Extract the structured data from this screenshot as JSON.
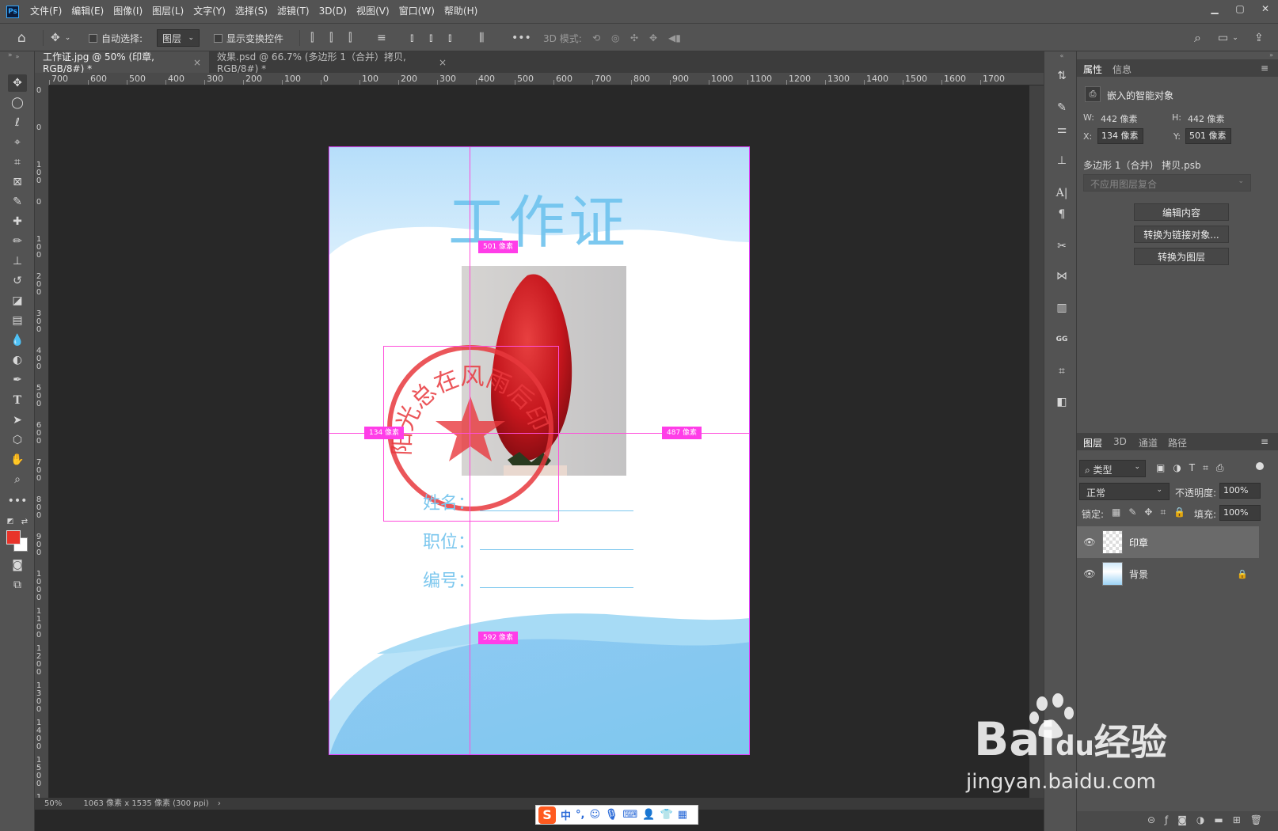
{
  "menubar": {
    "logo": "Ps",
    "items": [
      "文件(F)",
      "编辑(E)",
      "图像(I)",
      "图层(L)",
      "文字(Y)",
      "选择(S)",
      "滤镜(T)",
      "3D(D)",
      "视图(V)",
      "窗口(W)",
      "帮助(H)"
    ]
  },
  "options_bar": {
    "auto_select_label": "自动选择:",
    "auto_select_target": "图层",
    "show_transform_label": "显示变换控件",
    "mode_3d_label": "3D 模式:"
  },
  "tabs": [
    {
      "label": "工作证.jpg @ 50% (印章, RGB/8#) *",
      "active": true
    },
    {
      "label": "效果.psd @ 66.7% (多边形 1（合并）拷贝, RGB/8#) *",
      "active": false
    }
  ],
  "ruler_h": [
    "700",
    "600",
    "500",
    "400",
    "300",
    "200",
    "100",
    "0",
    "100",
    "200",
    "300",
    "400",
    "500",
    "600",
    "700",
    "800",
    "900",
    "1000",
    "1100",
    "1200",
    "1300",
    "1400",
    "1500",
    "1600",
    "1700"
  ],
  "ruler_v": [
    "0",
    "0",
    "1 0 0",
    "0",
    "1 0 0",
    "2 0 0",
    "3 0 0",
    "4 0 0",
    "5 0 0",
    "6 0 0",
    "7 0 0",
    "8 0 0",
    "9 0 0",
    "1 0 0 0",
    "1 1 0 0",
    "1 2 0 0",
    "1 3 0 0",
    "1 4 0 0",
    "1 5 0 0",
    "1 6 0 0"
  ],
  "document": {
    "title": "工作证",
    "stamp_text": "阳光总在风雨后印",
    "fields": [
      {
        "label": "姓名："
      },
      {
        "label": "职位："
      },
      {
        "label": "编号："
      }
    ],
    "measure_labels": {
      "top": "501 像素",
      "left": "134 像素",
      "right": "487 像素",
      "bottom": "592 像素"
    }
  },
  "status": {
    "zoom": "50%",
    "doc_size": "1063 像素 x 1535 像素 (300 ppi)"
  },
  "properties": {
    "tabs": [
      "属性",
      "信息"
    ],
    "type": "嵌入的智能对象",
    "w_label": "W:",
    "w": "442 像素",
    "h_label": "H:",
    "h": "442 像素",
    "x_label": "X:",
    "x": "134 像素",
    "y_label": "Y:",
    "y": "501 像素",
    "file": "多边形 1（合并） 拷贝.psb",
    "comp": "不应用图层复合",
    "buttons": [
      "编辑内容",
      "转换为链接对象...",
      "转换为图层"
    ]
  },
  "layers": {
    "tabs": [
      "图层",
      "3D",
      "通道",
      "路径"
    ],
    "filter": "类型",
    "blend": "正常",
    "opacity_label": "不透明度:",
    "opacity": "100%",
    "lock_label": "锁定:",
    "fill_label": "填充:",
    "fill": "100%",
    "items": [
      {
        "name": "印章",
        "selected": true
      },
      {
        "name": "背景",
        "selected": false
      }
    ]
  },
  "ime": {
    "brand": "S",
    "mode": "中"
  },
  "watermark": {
    "brand": "Bai",
    "brand2": "du",
    "cn": "经验",
    "url": "jingyan.baidu.com"
  },
  "colors": {
    "fg": "#e8342a",
    "bg": "#ffffff",
    "accent": "#ff3de8",
    "title_blue": "#6ec3ee",
    "stamp_red": "#e8383d"
  }
}
